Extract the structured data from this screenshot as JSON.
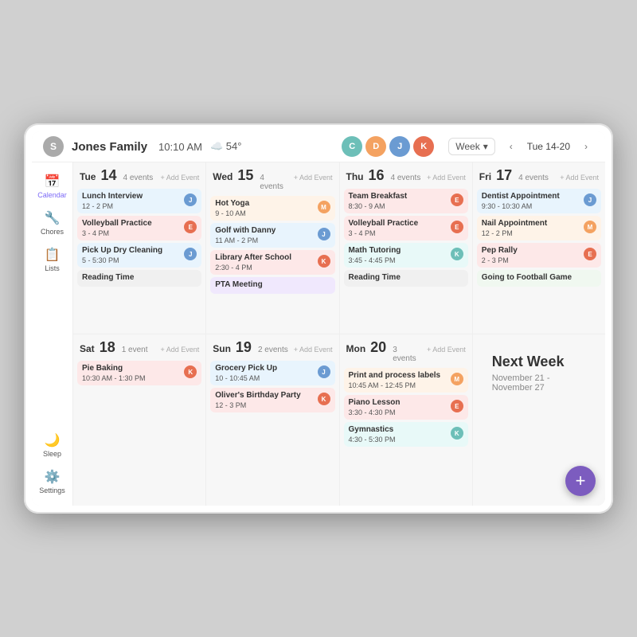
{
  "device": {
    "family_name": "Jones Family",
    "time": "10:10 AM",
    "weather_icon": "☁️",
    "temperature": "54°"
  },
  "avatars": [
    {
      "letter": "C",
      "color": "#6dbfb8"
    },
    {
      "letter": "D",
      "color": "#f4a261"
    },
    {
      "letter": "J",
      "color": "#6b9bd2"
    },
    {
      "letter": "K",
      "color": "#e76f51"
    }
  ],
  "week_selector": {
    "label": "Week",
    "date_range": "Tue 14-20"
  },
  "sidebar": {
    "items": [
      {
        "label": "Calendar",
        "icon": "📅"
      },
      {
        "label": "Chores",
        "icon": "🔧"
      },
      {
        "label": "Lists",
        "icon": "📋"
      },
      {
        "label": "Sleep",
        "icon": "🌙"
      },
      {
        "label": "Settings",
        "icon": "⚙️"
      }
    ]
  },
  "days": [
    {
      "name": "Tue",
      "num": "14",
      "events_count": "4 events",
      "add_event": "+ Add Event",
      "events": [
        {
          "title": "Lunch Interview",
          "time": "12 - 2 PM",
          "badge": "J",
          "badge_color": "#6b9bd2",
          "bg": "#e8f4fd"
        },
        {
          "title": "Volleyball Practice",
          "time": "3 - 4 PM",
          "badge": "E",
          "badge_color": "#e76f51",
          "bg": "#fde8e8"
        },
        {
          "title": "Pick Up Dry Cleaning",
          "time": "5 - 5:30 PM",
          "badge": "J",
          "badge_color": "#6b9bd2",
          "bg": "#e8f4fd"
        },
        {
          "title": "Reading Time",
          "time": "",
          "badge": "",
          "badge_color": "",
          "bg": "#f0f0f0"
        }
      ]
    },
    {
      "name": "Wed",
      "num": "15",
      "events_count": "4 events",
      "add_event": "+ Add Event",
      "events": [
        {
          "title": "Hot Yoga",
          "time": "9 - 10 AM",
          "badge": "M",
          "badge_color": "#f4a261",
          "bg": "#fef3e8"
        },
        {
          "title": "Golf with Danny",
          "time": "11 AM - 2 PM",
          "badge": "J",
          "badge_color": "#6b9bd2",
          "bg": "#e8f4fd"
        },
        {
          "title": "Library After School",
          "time": "2:30 - 4 PM",
          "badge": "K",
          "badge_color": "#e76f51",
          "bg": "#fde8e8"
        },
        {
          "title": "PTA Meeting",
          "time": "",
          "badge": "",
          "badge_color": "",
          "bg": "#f0e8fd"
        }
      ]
    },
    {
      "name": "Thu",
      "num": "16",
      "events_count": "4 events",
      "add_event": "+ Add Event",
      "events": [
        {
          "title": "Team Breakfast",
          "time": "8:30 - 9 AM",
          "badge": "E",
          "badge_color": "#e76f51",
          "bg": "#fde8e8"
        },
        {
          "title": "Volleyball Practice",
          "time": "3 - 4 PM",
          "badge": "E",
          "badge_color": "#e76f51",
          "bg": "#fde8e8"
        },
        {
          "title": "Math Tutoring",
          "time": "3:45 - 4:45 PM",
          "badge": "K",
          "badge_color": "#6dbfb8",
          "bg": "#e8f9f8"
        },
        {
          "title": "Reading Time",
          "time": "",
          "badge": "",
          "badge_color": "",
          "bg": "#f0f0f0"
        }
      ]
    },
    {
      "name": "Fri",
      "num": "17",
      "events_count": "4 events",
      "add_event": "+ Add Event",
      "events": [
        {
          "title": "Dentist Appointment",
          "time": "9:30 - 10:30 AM",
          "badge": "J",
          "badge_color": "#6b9bd2",
          "bg": "#e8f4fd"
        },
        {
          "title": "Nail Appointment",
          "time": "12 - 2 PM",
          "badge": "M",
          "badge_color": "#f4a261",
          "bg": "#fef3e8"
        },
        {
          "title": "Pep Rally",
          "time": "2 - 3 PM",
          "badge": "E",
          "badge_color": "#e76f51",
          "bg": "#fde8e8"
        },
        {
          "title": "Going to Football Game",
          "time": "",
          "badge": "",
          "badge_color": "",
          "bg": "#f0f8f0"
        }
      ]
    },
    {
      "name": "Sat",
      "num": "18",
      "events_count": "1 event",
      "add_event": "+ Add Event",
      "events": [
        {
          "title": "Pie Baking",
          "time": "10:30 AM - 1:30 PM",
          "badge": "K",
          "badge_color": "#e76f51",
          "bg": "#fde8e8"
        }
      ]
    },
    {
      "name": "Sun",
      "num": "19",
      "events_count": "2 events",
      "add_event": "+ Add Event",
      "events": [
        {
          "title": "Grocery Pick Up",
          "time": "10 - 10:45 AM",
          "badge": "J",
          "badge_color": "#6b9bd2",
          "bg": "#e8f4fd"
        },
        {
          "title": "Oliver's Birthday Party",
          "time": "12 - 3 PM",
          "badge": "K",
          "badge_color": "#e76f51",
          "bg": "#fde8e8"
        }
      ]
    },
    {
      "name": "Mon",
      "num": "20",
      "events_count": "3 events",
      "add_event": "+ Add Event",
      "events": [
        {
          "title": "Print and process labels",
          "time": "10:45 AM - 12:45 PM",
          "badge": "M",
          "badge_color": "#f4a261",
          "bg": "#fef3e8"
        },
        {
          "title": "Piano Lesson",
          "time": "3:30 - 4:30 PM",
          "badge": "E",
          "badge_color": "#e76f51",
          "bg": "#fde8e8"
        },
        {
          "title": "Gymnastics",
          "time": "4:30 - 5:30 PM",
          "badge": "K",
          "badge_color": "#6dbfb8",
          "bg": "#e8f9f8"
        }
      ]
    }
  ],
  "next_week": {
    "title": "Next Week",
    "dates": "November 21 - November 27"
  },
  "fab": {
    "label": "+"
  }
}
